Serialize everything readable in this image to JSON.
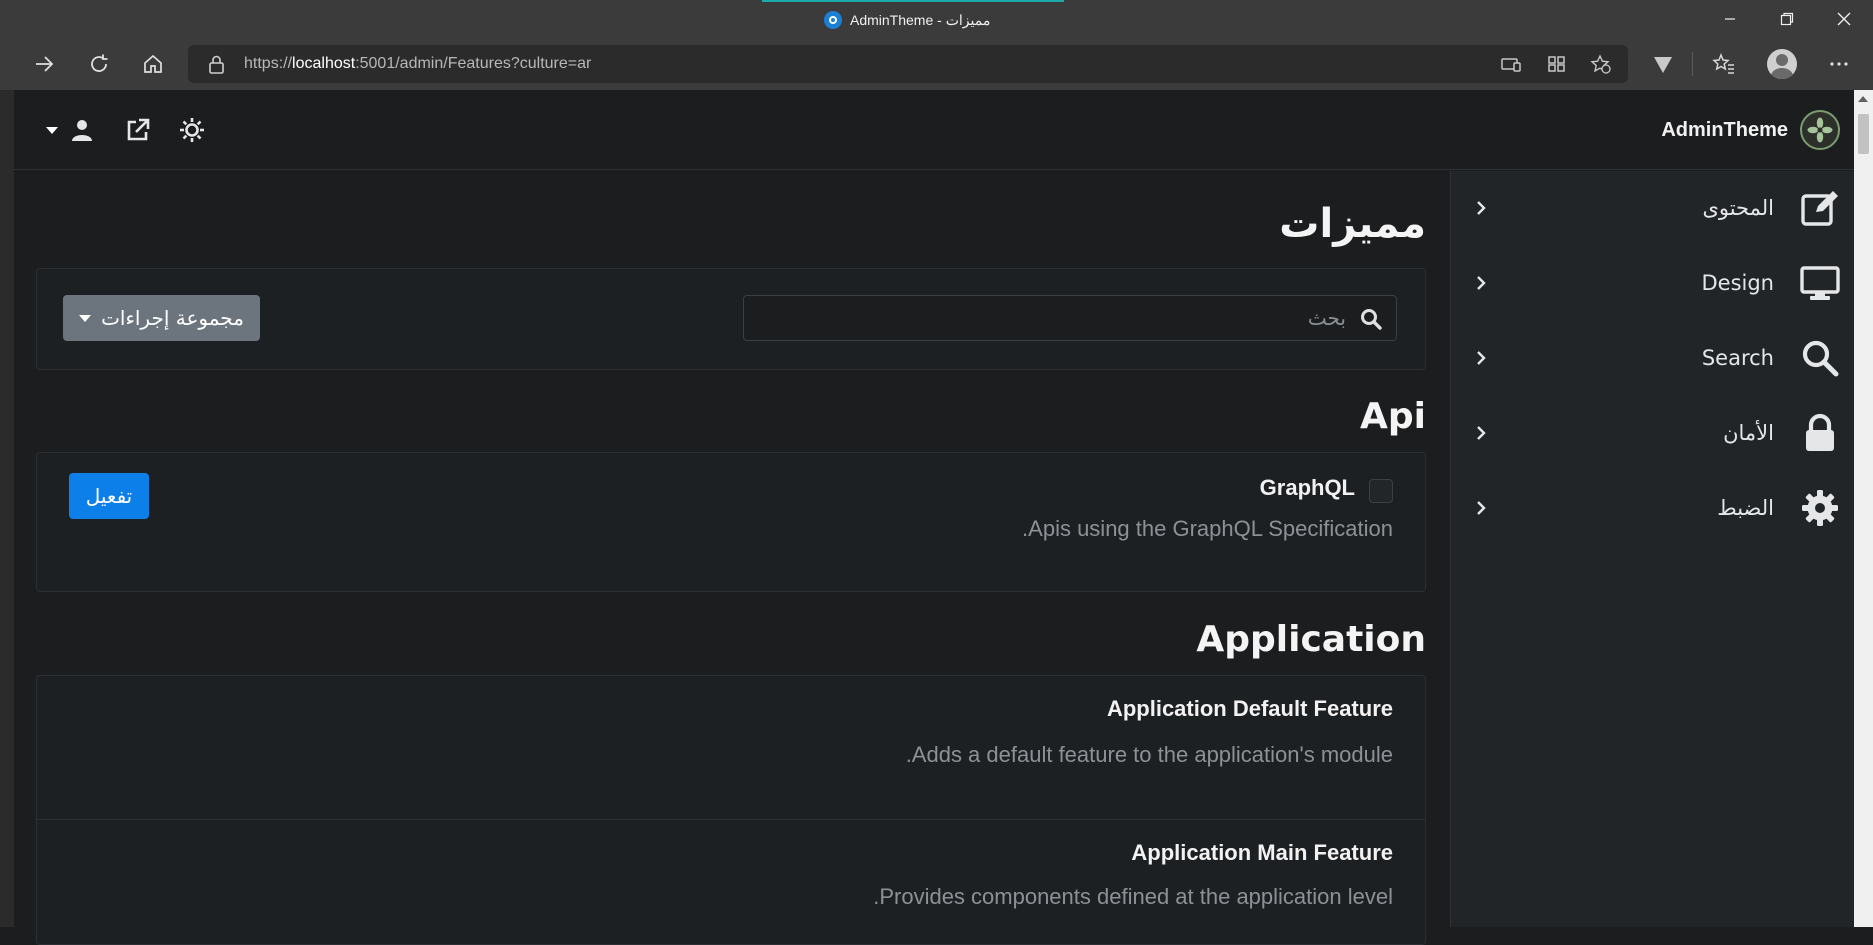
{
  "browser": {
    "tab_title": "AdminTheme - مميزات",
    "url_prefix": "https://",
    "url_host": "localhost",
    "url_rest": ":5001/admin/Features?culture=ar"
  },
  "header": {
    "brand": "AdminTheme"
  },
  "sidebar": {
    "items": [
      {
        "label": "المحتوى",
        "icon": "edit-icon"
      },
      {
        "label": "Design",
        "icon": "monitor-icon"
      },
      {
        "label": "Search",
        "icon": "search-icon"
      },
      {
        "label": "الأمان",
        "icon": "lock-icon"
      },
      {
        "label": "الضبط",
        "icon": "gear-icon"
      }
    ]
  },
  "main": {
    "page_title": "مميزات",
    "search_placeholder": "بحث",
    "bulk_actions_label": "مجموعة إجراءات",
    "groups": [
      {
        "title": "Api",
        "features": [
          {
            "name": "GraphQL",
            "description": ".Apis using the GraphQL Specification",
            "action": "تفعيل"
          }
        ]
      },
      {
        "title": "Application",
        "features": [
          {
            "name": "Application Default Feature",
            "description": ".Adds a default feature to the application's module"
          },
          {
            "name": "Application Main Feature",
            "description": ".Provides components defined at the application level"
          }
        ]
      }
    ]
  },
  "colors": {
    "accent": "#0d7fe8",
    "secondary_button": "#6c757d",
    "background": "#1b1d1f",
    "sidebar": "#222527"
  }
}
